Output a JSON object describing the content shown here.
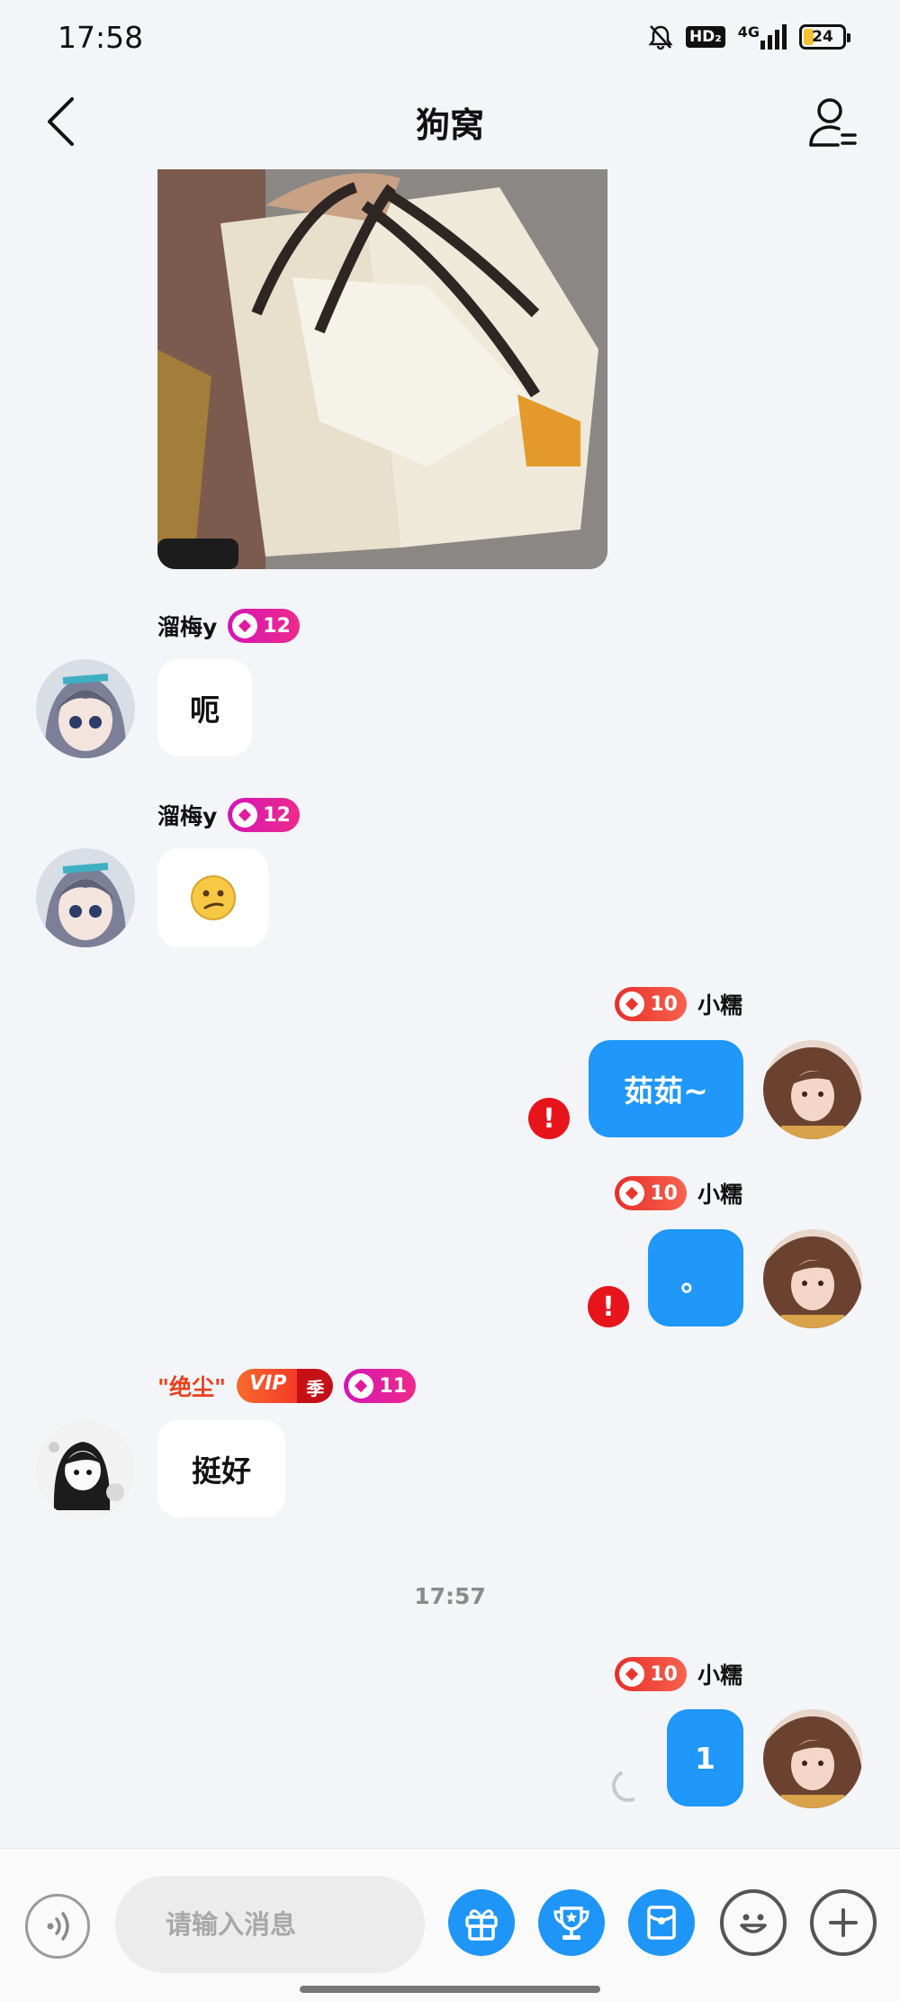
{
  "status_bar": {
    "time": "17:58",
    "icons": [
      "mute-bell-icon",
      "hd-icon",
      "signal-4g-icon",
      "battery-icon"
    ],
    "hd_label": "HD₂",
    "network": "4G",
    "battery": "24"
  },
  "header": {
    "title": "狗窝",
    "back_icon": "chevron-left-icon",
    "profile_icon": "group-members-icon"
  },
  "messages": [
    {
      "type": "image",
      "side": "in",
      "content": "photo of tote bags"
    },
    {
      "type": "text",
      "side": "in",
      "sender": "溜梅y",
      "level": "12",
      "text": "呃"
    },
    {
      "type": "emoji",
      "side": "in",
      "sender": "溜梅y",
      "level": "12",
      "text": "😕"
    },
    {
      "type": "text",
      "side": "out",
      "sender": "小糯",
      "level": "10",
      "text": "茹茹~",
      "failed": true
    },
    {
      "type": "text",
      "side": "out",
      "sender": "小糯",
      "level": "10",
      "text": "。",
      "failed": true
    },
    {
      "type": "text",
      "side": "in",
      "sender": "\"绝尘\"",
      "vip": "VIP",
      "vip_season": "季",
      "level": "11",
      "text": "挺好"
    },
    {
      "type": "text",
      "side": "out",
      "sender": "小糯",
      "level": "10",
      "text": "1",
      "sending": true
    }
  ],
  "time_separator": "17:57",
  "input_bar": {
    "placeholder": "请输入消息",
    "buttons": [
      "voice-icon",
      "gift-icon",
      "trophy-icon",
      "red-packet-icon",
      "emoji-icon",
      "plus-icon"
    ]
  },
  "colors": {
    "background": "#f4f5f9",
    "outgoing_bubble": "#1f97fb",
    "incoming_bubble": "#ffffff",
    "error": "#e8141c",
    "vip_name": "#e8401c"
  }
}
